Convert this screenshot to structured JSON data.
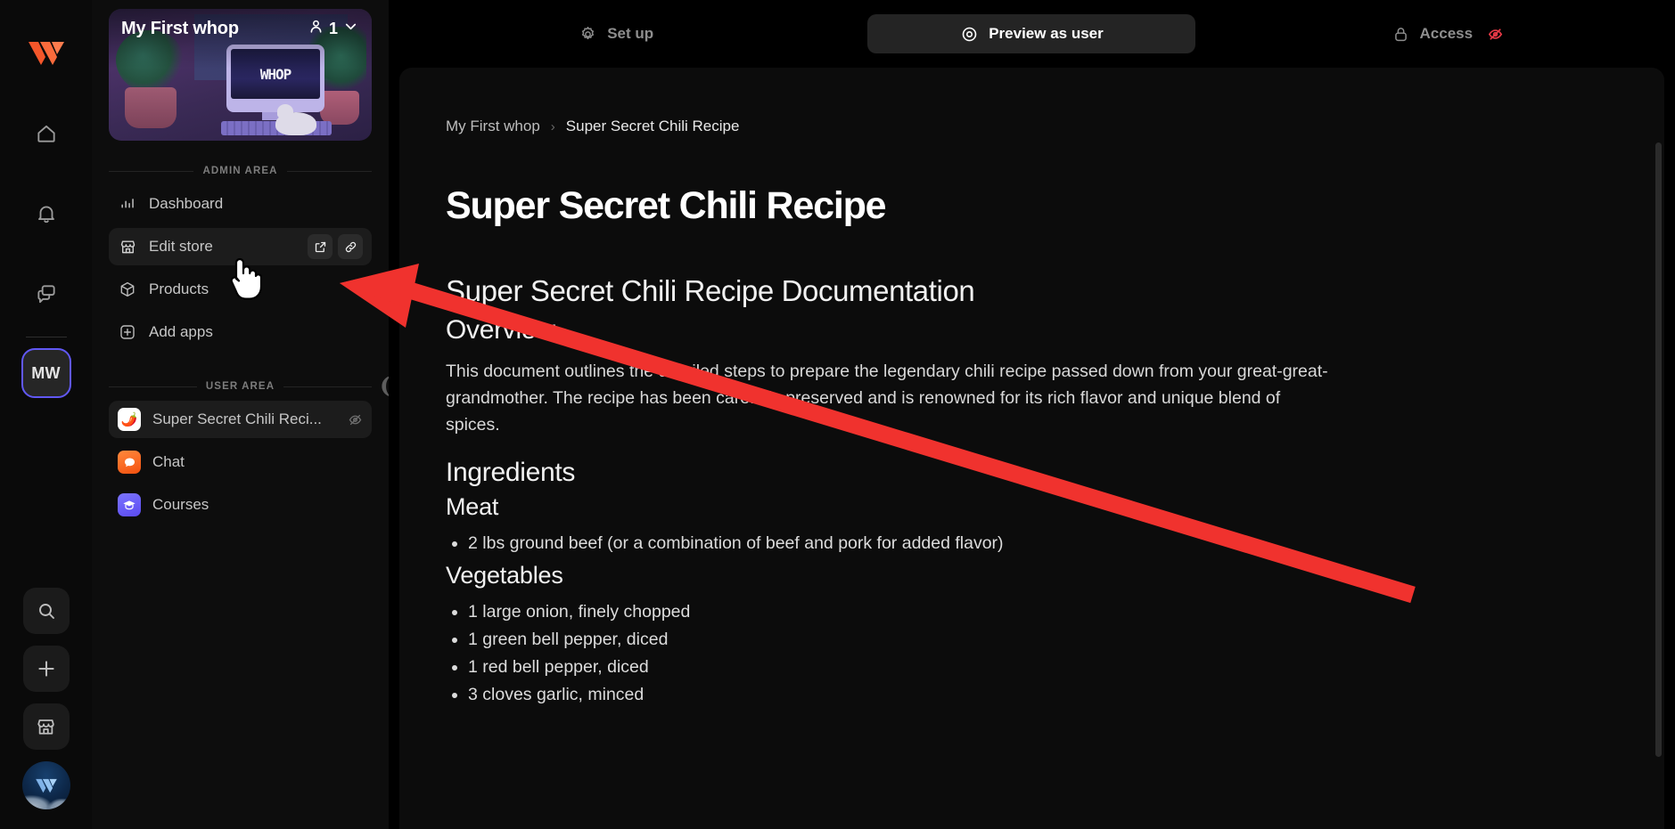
{
  "rail": {
    "logo_icon": "whop-logo-icon",
    "icons": [
      {
        "name": "home-icon",
        "label": "Home"
      },
      {
        "name": "bell-icon",
        "label": "Notifications"
      },
      {
        "name": "messages-icon",
        "label": "Messages"
      }
    ],
    "avatar_initials": "MW",
    "bottom_buttons": [
      {
        "name": "search-icon",
        "label": "Search"
      },
      {
        "name": "plus-icon",
        "label": "Create"
      },
      {
        "name": "storefront-icon",
        "label": "Store"
      }
    ],
    "profile_avatar": "user-avatar"
  },
  "sidebar": {
    "whop_card": {
      "title": "My First whop",
      "member_count": "1",
      "member_icon": "person-icon",
      "chevron_icon": "chevron-down-icon",
      "screen_text": "WHOP"
    },
    "admin_section_label": "ADMIN AREA",
    "admin_items": [
      {
        "label": "Dashboard",
        "icon": "bar-chart-icon",
        "active": false
      },
      {
        "label": "Edit store",
        "icon": "storefront-icon",
        "active": true,
        "actions": [
          "external-link-icon",
          "link-icon"
        ]
      },
      {
        "label": "Products",
        "icon": "cube-icon",
        "active": false
      },
      {
        "label": "Add apps",
        "icon": "plus-square-icon",
        "active": false
      }
    ],
    "user_section_label": "USER AREA",
    "user_items": [
      {
        "label": "Super Secret Chili Reci...",
        "emoji": "🌶️",
        "emoji_class": "emoji-chili",
        "active": true,
        "hidden_icon": "eye-off-icon"
      },
      {
        "label": "Chat",
        "emoji": "💬",
        "emoji_class": "emoji-chat",
        "active": false
      },
      {
        "label": "Courses",
        "emoji": "🎓",
        "emoji_class": "emoji-course",
        "active": false
      }
    ],
    "collapse_icon": "collapse-panel-handle"
  },
  "topbar": {
    "setup": {
      "label": "Set up",
      "icon": "gear-icon",
      "active": false
    },
    "preview": {
      "label": "Preview as user",
      "icon": "target-icon",
      "active": true
    },
    "access": {
      "label": "Access",
      "icon": "lock-icon",
      "status_icon": "eye-off-icon",
      "status_color": "#e63946"
    }
  },
  "breadcrumb": {
    "items": [
      "My First whop",
      "Super Secret Chili Recipe"
    ],
    "separator": "›"
  },
  "document": {
    "page_title": "Super Secret Chili Recipe",
    "h2": "Super Secret Chili Recipe Documentation",
    "overview_heading": "Overview",
    "overview_text": "This document outlines the detailed steps to prepare the legendary chili recipe passed down from your great-great-grandmother. The recipe has been carefully preserved and is renowned for its rich flavor and unique blend of spices.",
    "ingredients_heading": "Ingredients",
    "meat_heading": "Meat",
    "meat_items": [
      "2 lbs ground beef (or a combination of beef and pork for added flavor)"
    ],
    "vegetables_heading": "Vegetables",
    "vegetable_items": [
      "1 large onion, finely chopped",
      "1 green bell pepper, diced",
      "1 red bell pepper, diced",
      "3 cloves garlic, minced"
    ]
  },
  "annotation": {
    "arrow_color": "#f0322e",
    "arrow_target": "edit-store-external-link-button"
  }
}
